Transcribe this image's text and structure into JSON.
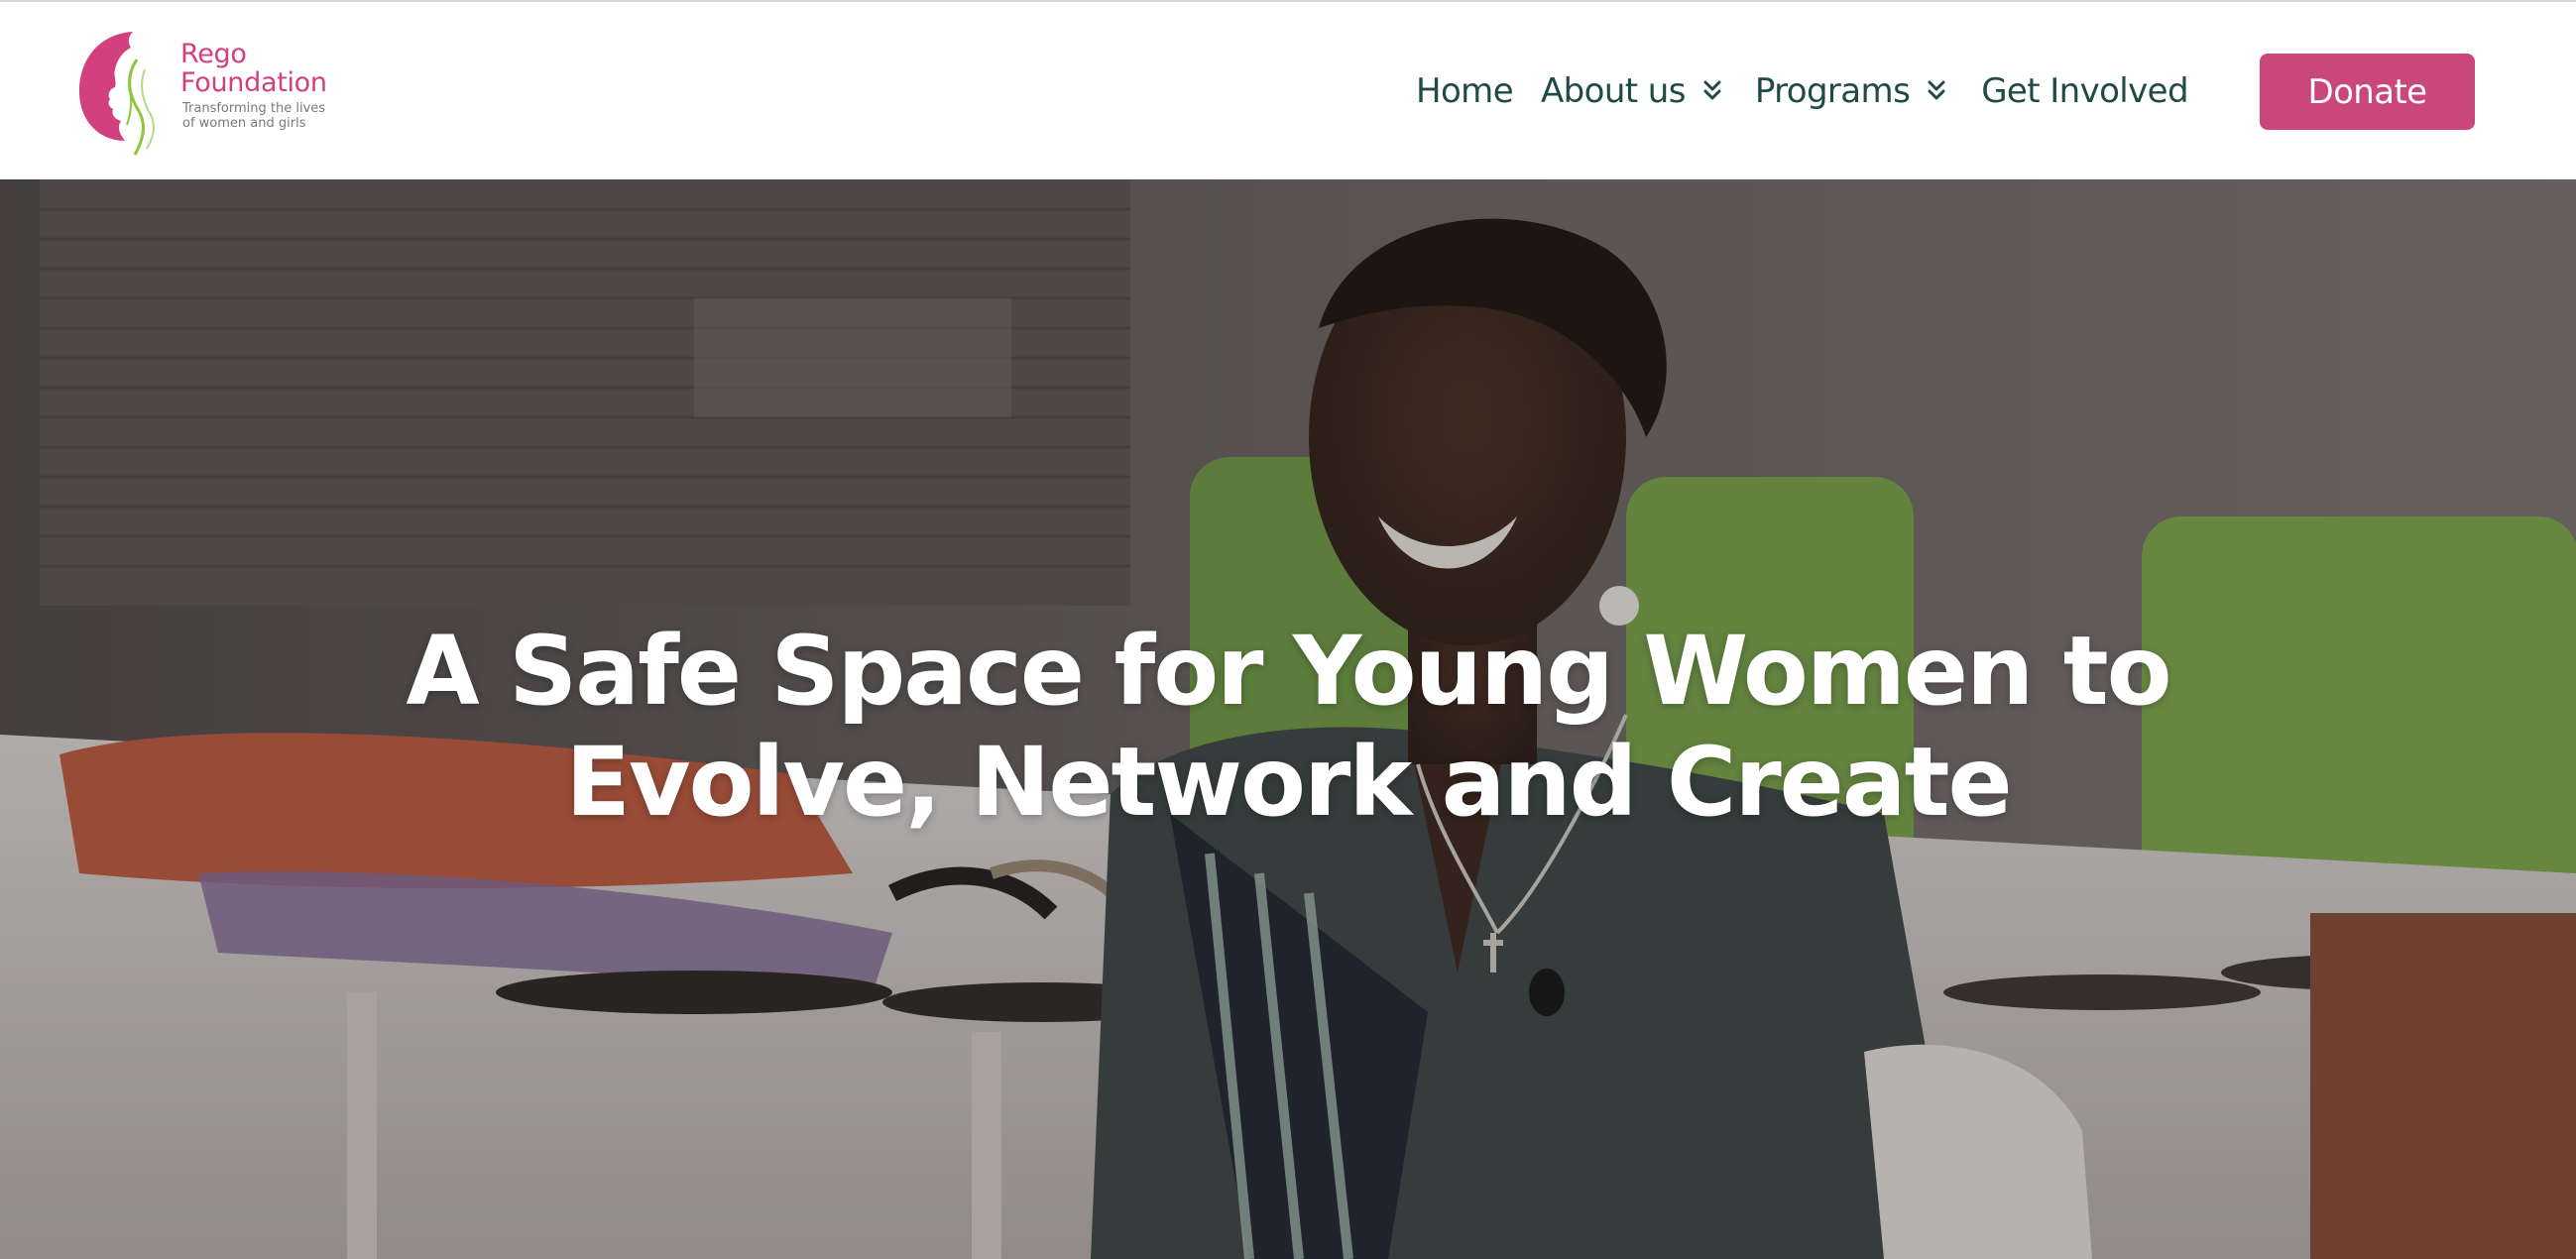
{
  "header": {
    "logo": {
      "name_line1": "Rego",
      "name_line2": "Foundation",
      "tagline_line1": "Transforming the lives",
      "tagline_line2": "of women and girls",
      "icon": "woman-profile-logo-icon"
    },
    "nav": {
      "home": "Home",
      "about": "About us",
      "programs": "Programs",
      "get_involved": "Get Involved",
      "dropdown_icon": "double-chevron-down-icon"
    },
    "donate_label": "Donate"
  },
  "hero": {
    "title_line1": "A Safe Space for Young Women to",
    "title_line2": "Evolve, Network and Create",
    "background": "photo-smiling-woman-with-sandals"
  },
  "colors": {
    "brand_pink": "#c9477b",
    "logo_pink": "#d2407f",
    "nav_text": "#1f4a45",
    "logo_green": "#8dc63f"
  }
}
